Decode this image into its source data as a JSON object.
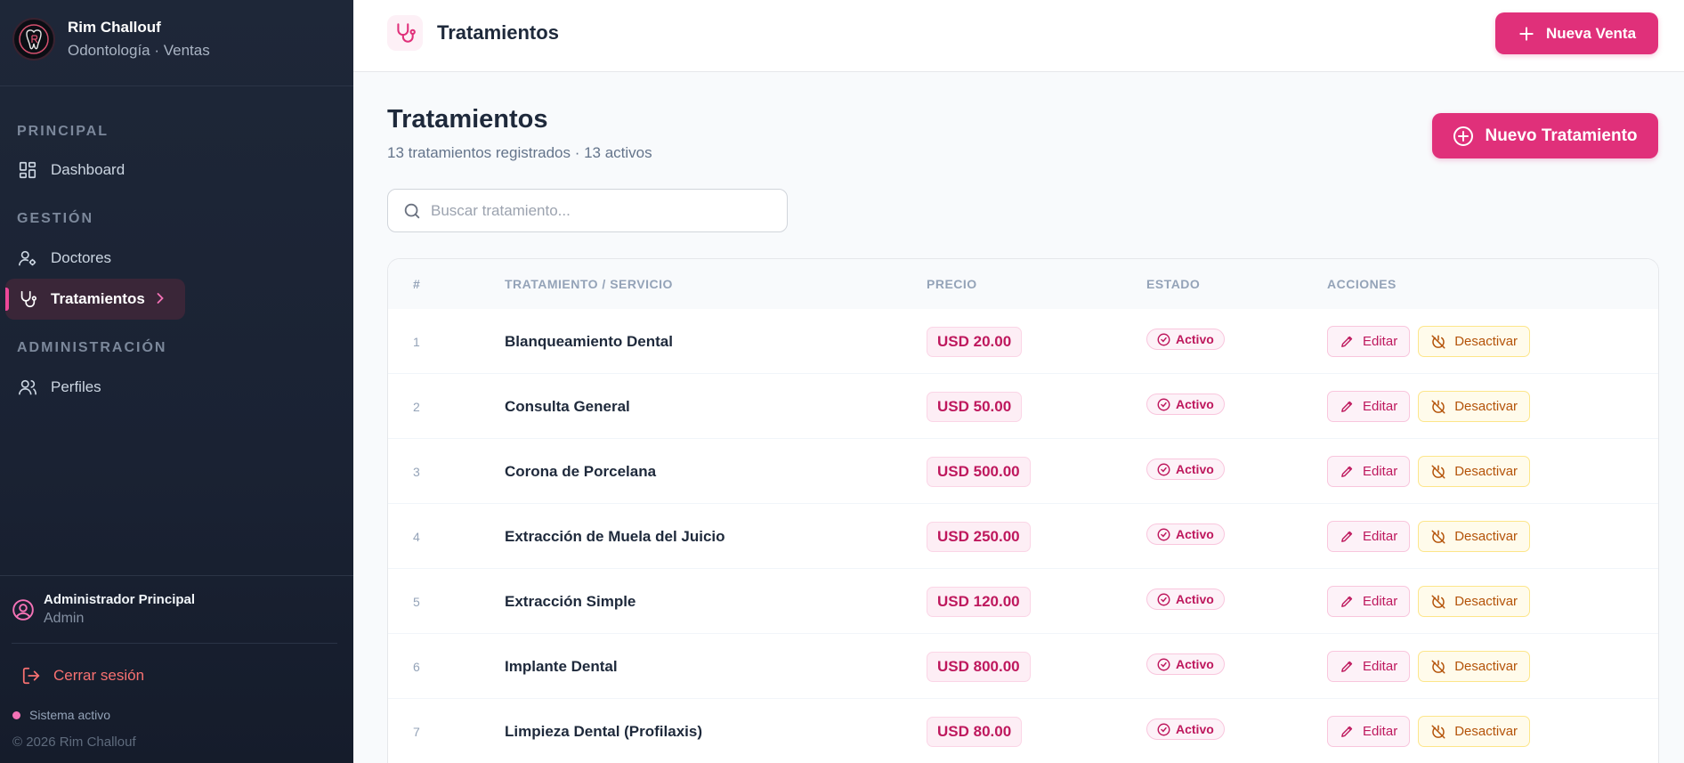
{
  "brand": {
    "name": "Rim Challouf",
    "subtitle": "Odontología · Ventas"
  },
  "sidebar": {
    "sections": {
      "principal": "PRINCIPAL",
      "gestion": "GESTIÓN",
      "administracion": "ADMINISTRACIÓN"
    },
    "items": {
      "dashboard": "Dashboard",
      "doctores": "Doctores",
      "tratamientos": "Tratamientos",
      "perfiles": "Perfiles"
    },
    "active_item": "tratamientos",
    "user": {
      "name": "Administrador Principal",
      "role": "Admin"
    },
    "logout_label": "Cerrar sesión",
    "status_text": "Sistema activo",
    "copyright": "© 2026 Rim Challouf"
  },
  "header": {
    "title": "Tratamientos",
    "icon": "stethoscope-icon",
    "new_sale_label": "Nueva Venta"
  },
  "main": {
    "title": "Tratamientos",
    "subtitle": "13 tratamientos registrados · 13 activos",
    "new_treatment_label": "Nuevo Tratamiento",
    "search": {
      "placeholder": "Buscar tratamiento...",
      "value": ""
    },
    "table": {
      "columns": {
        "num": "#",
        "name": "TRATAMIENTO / SERVICIO",
        "price": "PRECIO",
        "state": "ESTADO",
        "actions": "ACCIONES"
      },
      "edit_label": "Editar",
      "deactivate_label": "Desactivar",
      "rows": [
        {
          "num": "1",
          "name": "Blanqueamiento Dental",
          "price": "USD 20.00",
          "state": "Activo"
        },
        {
          "num": "2",
          "name": "Consulta General",
          "price": "USD 50.00",
          "state": "Activo"
        },
        {
          "num": "3",
          "name": "Corona de Porcelana",
          "price": "USD 500.00",
          "state": "Activo"
        },
        {
          "num": "4",
          "name": "Extracción de Muela del Juicio",
          "price": "USD 250.00",
          "state": "Activo"
        },
        {
          "num": "5",
          "name": "Extracción Simple",
          "price": "USD 120.00",
          "state": "Activo"
        },
        {
          "num": "6",
          "name": "Implante Dental",
          "price": "USD 800.00",
          "state": "Activo"
        },
        {
          "num": "7",
          "name": "Limpieza Dental (Profilaxis)",
          "price": "USD 80.00",
          "state": "Activo"
        }
      ]
    }
  },
  "colors": {
    "accent": "#e0307a",
    "sidebar_bg": "#1e2738",
    "logout": "#f87171",
    "warning": "#b45309"
  }
}
